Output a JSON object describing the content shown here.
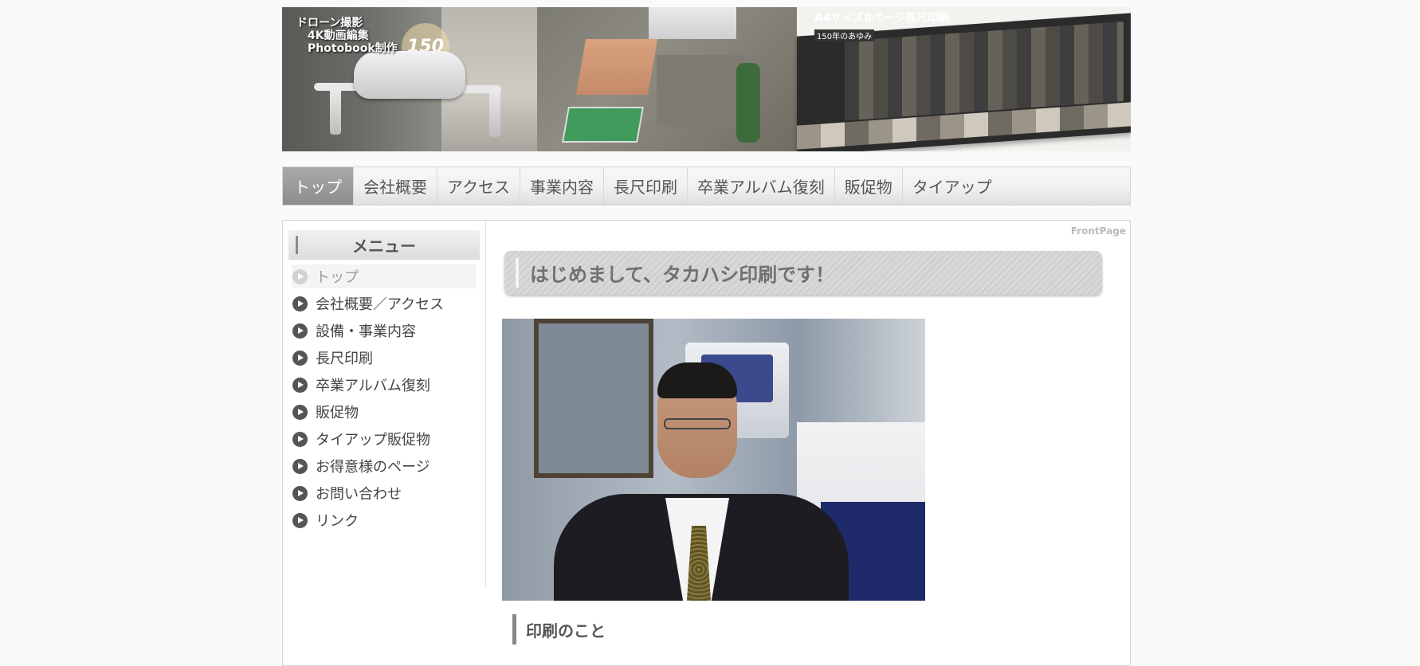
{
  "header": {
    "banner_left_caption": [
      "ドローン撮影",
      "4K動画編集",
      "Photobook制作"
    ],
    "banner_badge": "150",
    "banner_right_title": "A4サイズ8ページ長尺印刷",
    "banner_right_sub": "150年のあゆみ"
  },
  "topnav": {
    "items": [
      {
        "label": "トップ",
        "active": true
      },
      {
        "label": "会社概要"
      },
      {
        "label": "アクセス"
      },
      {
        "label": "事業内容"
      },
      {
        "label": "長尺印刷"
      },
      {
        "label": "卒業アルバム復刻"
      },
      {
        "label": "販促物"
      },
      {
        "label": "タイアップ"
      }
    ]
  },
  "sidebar": {
    "heading": "メニュー",
    "items": [
      {
        "label": "トップ",
        "current": true
      },
      {
        "label": "会社概要／アクセス"
      },
      {
        "label": "設備・事業内容"
      },
      {
        "label": "長尺印刷"
      },
      {
        "label": "卒業アルバム復刻"
      },
      {
        "label": "販促物"
      },
      {
        "label": "タイアップ販促物"
      },
      {
        "label": "お得意様のページ"
      },
      {
        "label": "お問い合わせ"
      },
      {
        "label": "リンク"
      }
    ]
  },
  "content": {
    "page_label": "FrontPage",
    "title": "はじめまして、タカハシ印刷です！",
    "section_heading": "印刷のこと"
  }
}
